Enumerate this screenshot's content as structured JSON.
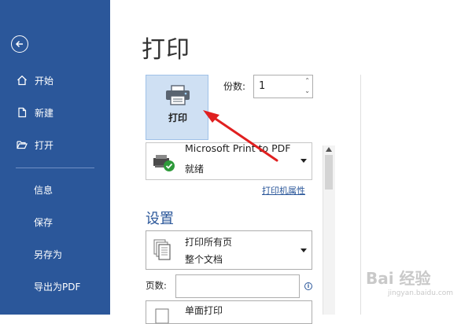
{
  "sidebar": {
    "items": [
      {
        "label": "开始",
        "icon": "home-icon"
      },
      {
        "label": "新建",
        "icon": "new-document-icon"
      },
      {
        "label": "打开",
        "icon": "folder-open-icon"
      },
      {
        "label": "信息"
      },
      {
        "label": "保存"
      },
      {
        "label": "另存为"
      },
      {
        "label": "导出为PDF"
      }
    ],
    "bg_color": "#2b579a"
  },
  "page": {
    "title": "打印"
  },
  "print": {
    "button_label": "打印",
    "copies_label": "份数:",
    "copies_value": "1"
  },
  "printer": {
    "name": "Microsoft Print to PDF",
    "status": "就绪",
    "properties_link": "打印机属性"
  },
  "settings": {
    "heading": "设置",
    "range_line1": "打印所有页",
    "range_line2": "整个文档",
    "pages_label": "页数:",
    "pages_value": "",
    "sides_line1": "单面打印"
  },
  "watermark": {
    "text": "Bai 经验",
    "sub": "jingyan.baidu.com"
  },
  "colors": {
    "accent": "#2b579a",
    "annotation_arrow": "#e02020",
    "print_button_bg": "#cfe0f3"
  }
}
